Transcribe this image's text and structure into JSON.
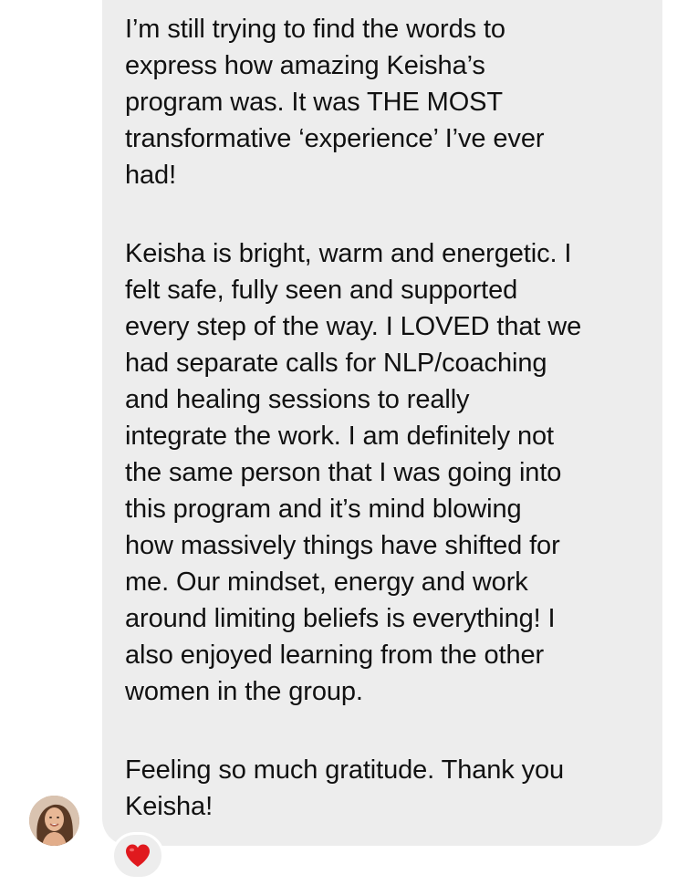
{
  "message": {
    "paragraphs": [
      {
        "lines": [
          "I’m still trying to find the words to",
          "express how amazing Keisha’s",
          "program was. It was THE MOST",
          "transformative ‘experience’ I’ve ever",
          "had!"
        ]
      },
      {
        "lines": [
          "Keisha is bright, warm and energetic. I",
          "felt safe, fully seen and supported",
          "every step of the way. I LOVED that we",
          "had separate calls for NLP/coaching",
          "and healing sessions to really",
          "integrate the work. I am definitely not",
          "the same person that I was going into",
          "this program and it’s mind blowing",
          "how massively things have shifted for",
          "me. Our mindset, energy and work",
          "around limiting beliefs is everything! I",
          "also enjoyed learning from the other",
          "women in the group."
        ]
      },
      {
        "lines": [
          "Feeling so much gratitude. Thank you",
          "Keisha!"
        ]
      }
    ]
  },
  "reaction": {
    "icon": "heart-icon",
    "color": "#e0191e"
  },
  "avatar": {
    "icon": "profile-photo"
  },
  "colors": {
    "bubble": "#ededed",
    "text": "#111111",
    "background": "#ffffff"
  }
}
